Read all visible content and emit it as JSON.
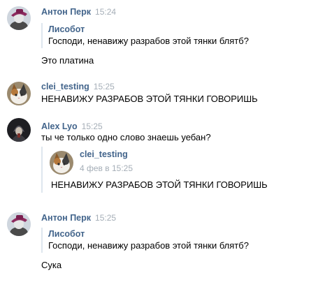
{
  "messages": [
    {
      "author": "Антон Перк",
      "time": "15:24",
      "avatar_icon": "purple-hat-avatar-icon",
      "quote": {
        "author": "Лисобот",
        "text": "Господи, ненавижу разрабов этой тянки блятб?"
      },
      "text": "Это платина"
    },
    {
      "author": "clei_testing",
      "time": "15:25",
      "avatar_icon": "cat-avatar-icon",
      "text": "НЕНАВИЖУ РАЗРАБОВ ЭТОЙ ТЯНКИ ГОВОРИШЬ"
    },
    {
      "author": "Alex Lyo",
      "time": "15:25",
      "avatar_icon": "dark-hooded-avatar-icon",
      "text": "ты че только одно слово знаешь уебан?",
      "forward": {
        "author": "clei_testing",
        "date": "4 фев в 15:25",
        "text": "НЕНАВИЖУ РАЗРАБОВ ЭТОЙ ТЯНКИ ГОВОРИШЬ"
      }
    },
    {
      "author": "Антон Перк",
      "time": "15:25",
      "avatar_icon": "purple-hat-avatar-icon",
      "quote": {
        "author": "Лисобот",
        "text": "Господи, ненавижу разрабов этой тянки блятб?"
      },
      "text": "Сука"
    }
  ],
  "colors": {
    "author": "#42648b",
    "time": "#a5aeb7",
    "quote_bar": "#dee6ee"
  }
}
